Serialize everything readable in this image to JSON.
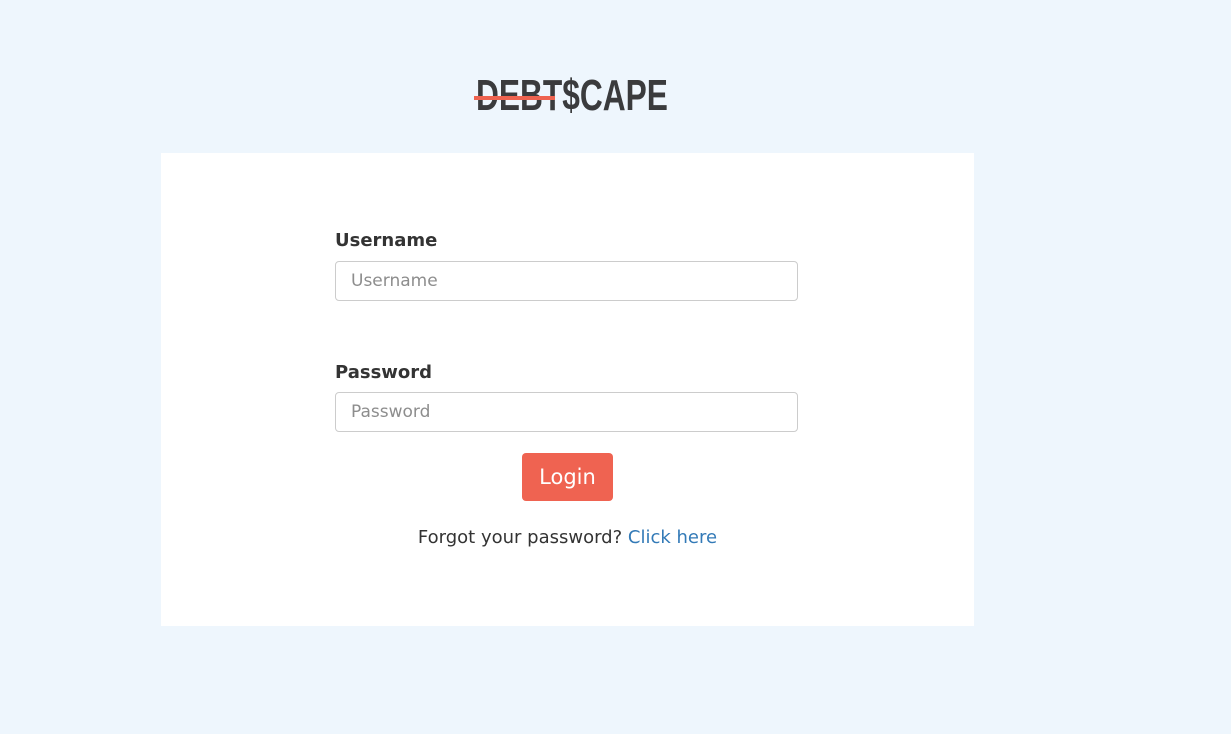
{
  "logo": {
    "text_debt": "DEBT",
    "text_scape": "$CAPE",
    "strike_color": "#ee6350"
  },
  "form": {
    "username_label": "Username",
    "username_placeholder": "Username",
    "username_value": "",
    "password_label": "Password",
    "password_placeholder": "Password",
    "password_value": "",
    "login_label": "Login",
    "forgot_text": "Forgot your password?",
    "forgot_link": "Click here"
  },
  "colors": {
    "background": "#eef6fd",
    "accent": "#ef6351",
    "link": "#337ab7"
  }
}
